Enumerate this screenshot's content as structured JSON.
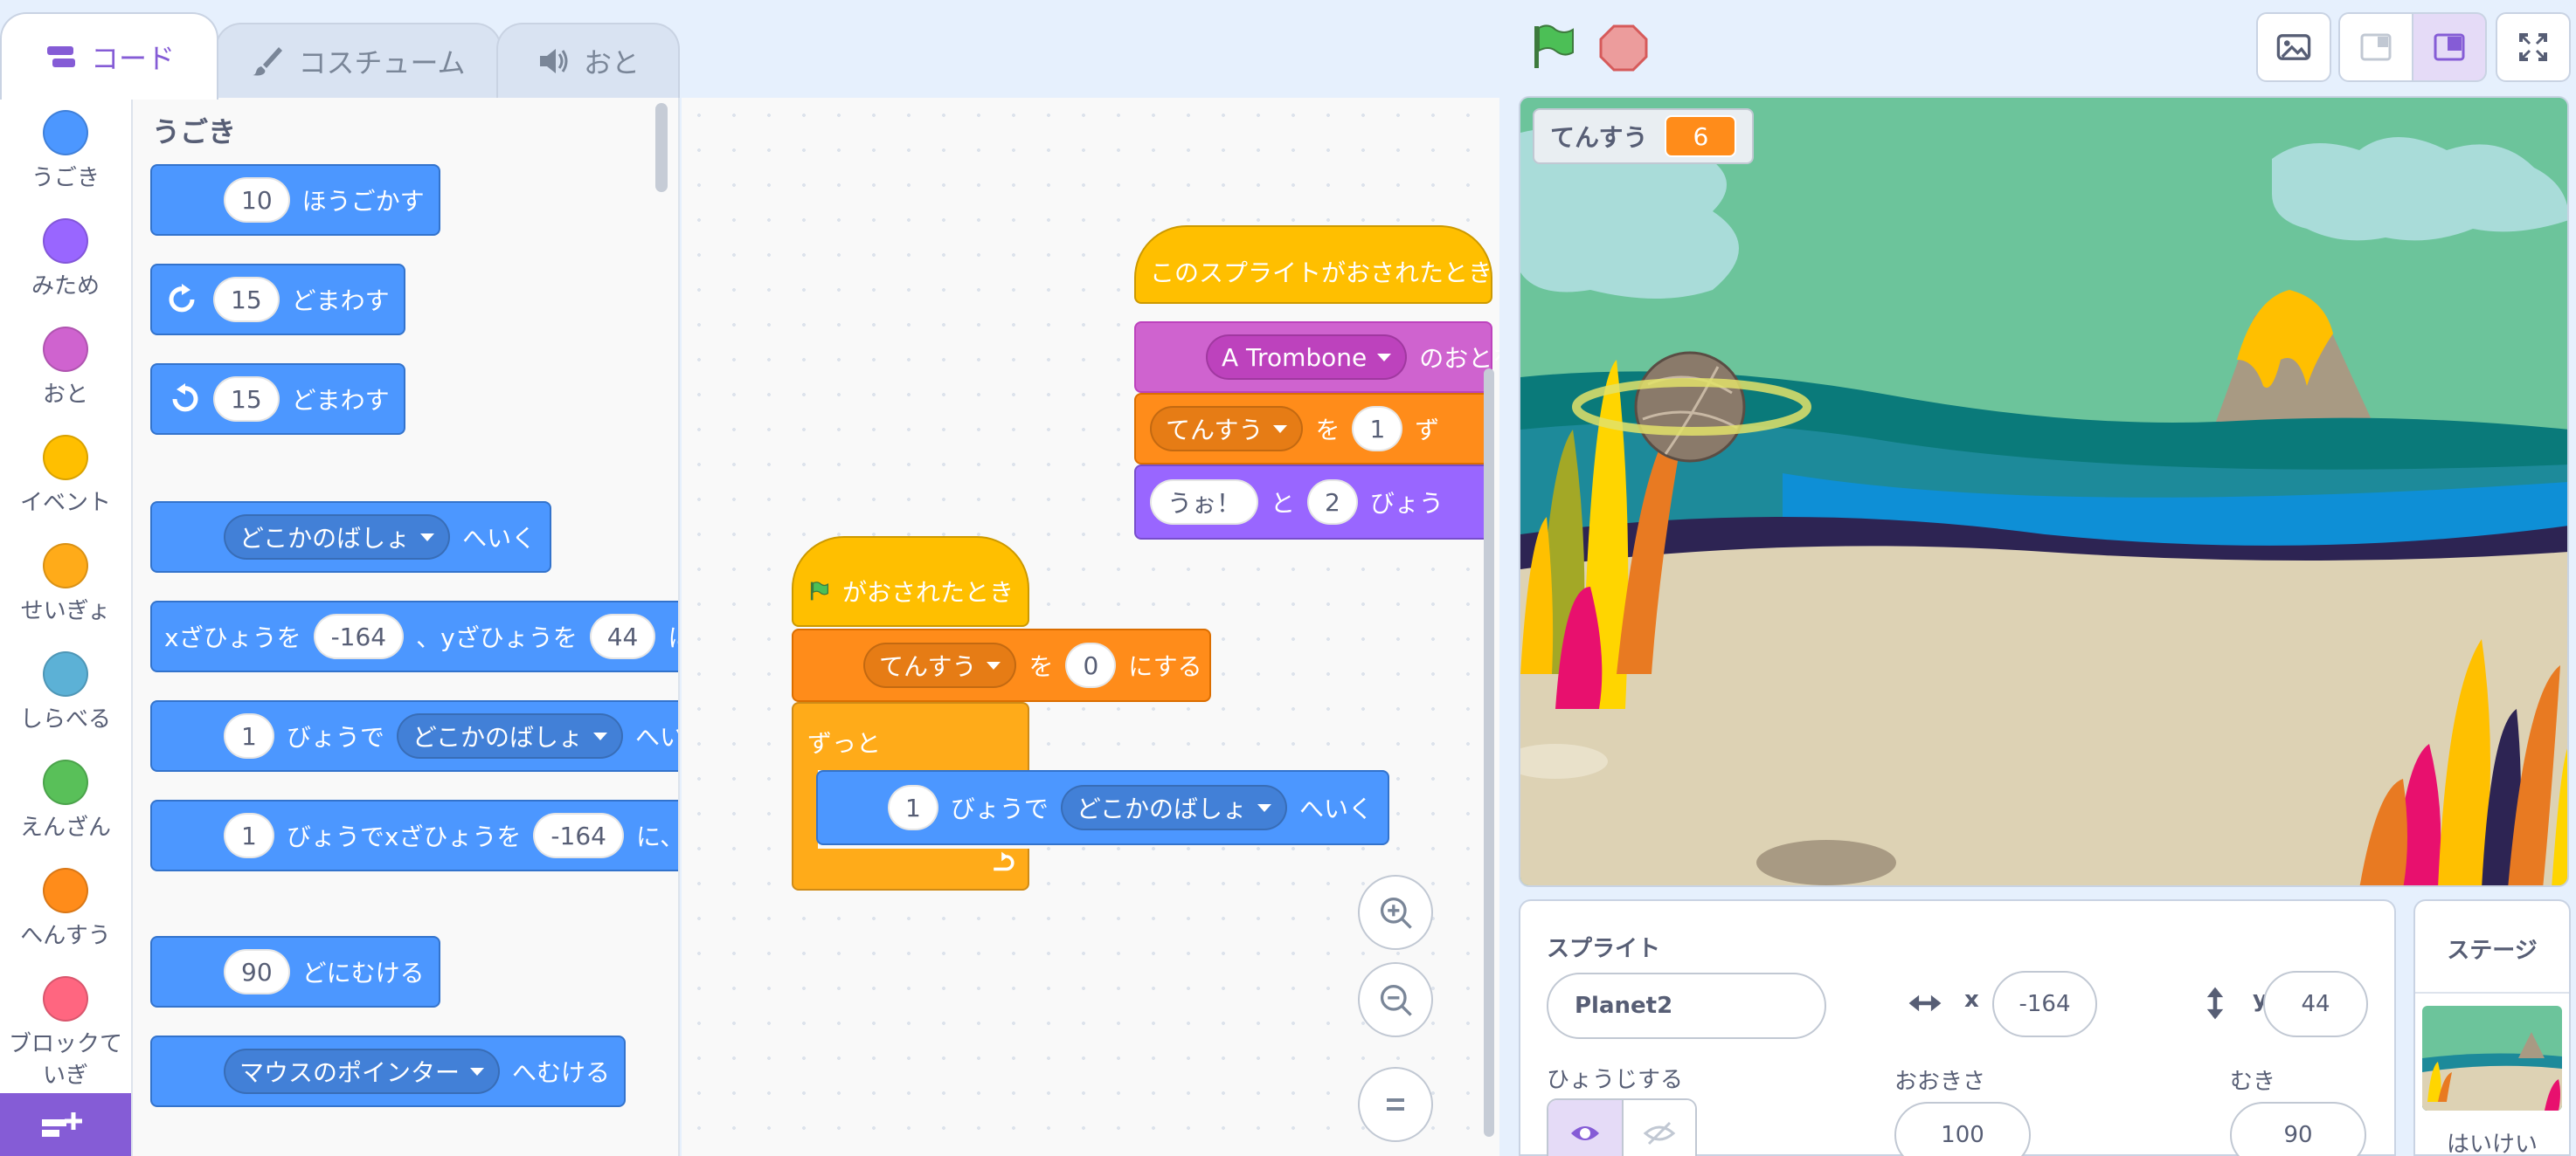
{
  "tabs": [
    {
      "label": "コード",
      "icon": "code-icon",
      "active": true
    },
    {
      "label": "コスチューム",
      "icon": "brush-icon",
      "active": false
    },
    {
      "label": "おと",
      "icon": "speaker-icon",
      "active": false
    }
  ],
  "categories": [
    {
      "label": "うごき",
      "color": "#4c97ff"
    },
    {
      "label": "みため",
      "color": "#9966ff"
    },
    {
      "label": "おと",
      "color": "#cf63cf"
    },
    {
      "label": "イベント",
      "color": "#ffbf00"
    },
    {
      "label": "せいぎょ",
      "color": "#ffab19"
    },
    {
      "label": "しらべる",
      "color": "#5cb1d6"
    },
    {
      "label": "えんざん",
      "color": "#59c059"
    },
    {
      "label": "へんすう",
      "color": "#ff8c1a"
    },
    {
      "label": "ブロックて\nいぎ",
      "color": "#ff6680"
    }
  ],
  "palette": {
    "section": "うごき",
    "move": {
      "value": "10",
      "text": "ほうごかす"
    },
    "turn_right": {
      "value": "15",
      "text": "どまわす"
    },
    "turn_left": {
      "value": "15",
      "text": "どまわす"
    },
    "goto": {
      "menu": "どこかのばしょ",
      "text": "へいく"
    },
    "gotoxy": {
      "t1": "xざひょうを",
      "x": "-164",
      "t2": "、yざひょうを",
      "y": "44",
      "t3": "にす"
    },
    "glide": {
      "value": "1",
      "t1": "びょうで",
      "menu": "どこかのばしょ",
      "t2": "へい"
    },
    "glidexy": {
      "value": "1",
      "t1": "びょうでxざひょうを",
      "x": "-164",
      "t2": "に、y"
    },
    "point": {
      "value": "90",
      "text": "どにむける"
    },
    "pointto": {
      "menu": "マウスのポインター",
      "text": "へむける"
    }
  },
  "script1": {
    "hat": "このスプライトがおされたとき",
    "sound": {
      "menu": "A Trombone",
      "text": "のおとを"
    },
    "change": {
      "menu": "てんすう",
      "t1": "を",
      "value": "1",
      "t2": "ず"
    },
    "say": {
      "value": "うぉ！",
      "t1": "と",
      "secs": "2",
      "t2": "びょう"
    }
  },
  "script2": {
    "hat": "がおされたとき",
    "set": {
      "menu": "てんすう",
      "t1": "を",
      "value": "0",
      "t2": "にする"
    },
    "forever": "ずっと",
    "glide": {
      "value": "1",
      "t1": "びょうで",
      "menu": "どこかのばしょ",
      "t2": "へいく"
    }
  },
  "stage": {
    "monitor_label": "てんすう",
    "monitor_value": "6"
  },
  "sprite_info": {
    "title": "スプライト",
    "name": "Planet2",
    "x_label": "x",
    "x": "-164",
    "y_label": "y",
    "y": "44",
    "show_label": "ひょうじする",
    "size_label": "おおきさ",
    "size": "100",
    "direction_label": "むき",
    "direction": "90"
  },
  "stage_pane": {
    "title": "ステージ",
    "backdrop_label": "はいけい"
  }
}
